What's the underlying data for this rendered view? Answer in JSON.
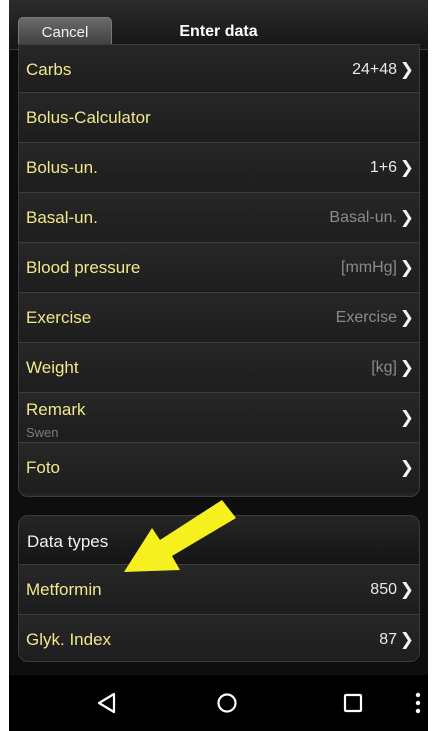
{
  "header": {
    "cancel_label": "Cancel",
    "title": "Enter data"
  },
  "main_list": [
    {
      "label": "Carbs",
      "value": "24+48",
      "value_style": "normal",
      "chevron": true
    },
    {
      "label": "Bolus-Calculator",
      "value": "",
      "value_style": "normal",
      "chevron": false
    },
    {
      "label": "Bolus-un.",
      "value": "1+6",
      "value_style": "normal",
      "chevron": true
    },
    {
      "label": "Basal-un.",
      "value": "Basal-un.",
      "value_style": "dim",
      "chevron": true
    },
    {
      "label": "Blood pressure",
      "value": "[mmHg]",
      "value_style": "dim",
      "chevron": true
    },
    {
      "label": "Exercise",
      "value": "Exercise",
      "value_style": "dim",
      "chevron": true
    },
    {
      "label": "Weight",
      "value": "[kg]",
      "value_style": "dim",
      "chevron": true
    },
    {
      "label": "Remark",
      "sub": "Swen",
      "value": "",
      "value_style": "normal",
      "chevron": true
    },
    {
      "label": "Foto",
      "value": "",
      "value_style": "normal",
      "chevron": true
    }
  ],
  "data_types": {
    "title": "Data types",
    "items": [
      {
        "label": "Metformin",
        "value": "850",
        "chevron": true
      },
      {
        "label": "Glyk. Index",
        "value": "87",
        "chevron": true
      }
    ]
  },
  "chevron_glyph": "❯",
  "annotation": {
    "color": "#f5f01e",
    "icon": "arrow-annotation-icon"
  },
  "navbar": {
    "icons": [
      "back-triangle-icon",
      "home-circle-icon",
      "recents-square-icon",
      "more-vert-icon"
    ]
  },
  "colors": {
    "label_text": "#f0e88a",
    "background": "#0e0e0e",
    "row_background": "#242424"
  }
}
